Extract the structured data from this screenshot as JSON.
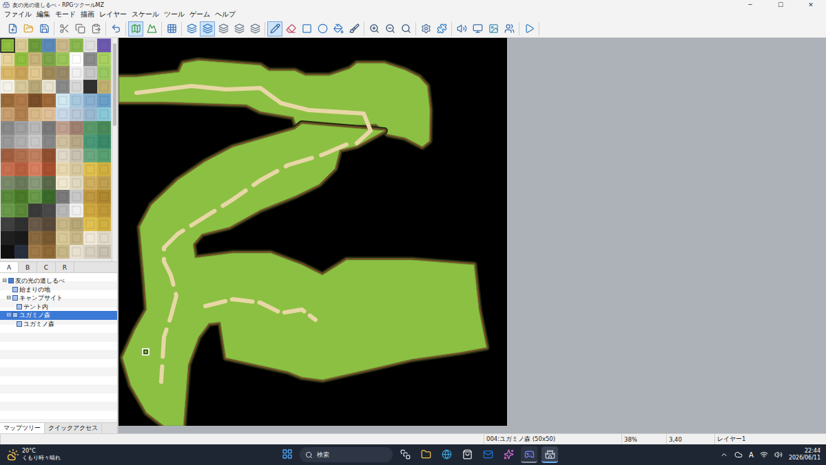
{
  "window": {
    "title": "友の光の道しるべ - RPGツクールMZ",
    "controls": [
      "─",
      "☐",
      "✕"
    ]
  },
  "menu": [
    "ファイル",
    "編集",
    "モード",
    "描画",
    "レイヤー",
    "スケール",
    "ツール",
    "ゲーム",
    "ヘルプ"
  ],
  "toolbar": [
    [
      {
        "selected": false
      },
      {
        "selected": false
      },
      {
        "selected": false
      }
    ],
    [
      {
        "selected": false
      },
      {
        "selected": false
      },
      {
        "selected": false
      }
    ],
    [
      {
        "selected": false
      }
    ],
    [
      {
        "selected": true
      },
      {
        "selected": false
      }
    ],
    [
      {
        "selected": false
      }
    ],
    [
      {
        "selected": false
      },
      {
        "selected": true
      },
      {
        "selected": false
      },
      {
        "selected": false
      },
      {
        "selected": false
      }
    ],
    [
      {
        "selected": true
      },
      {
        "selected": false
      },
      {
        "selected": false
      },
      {
        "selected": false
      },
      {
        "selected": false
      },
      {
        "selected": false
      }
    ],
    [
      {
        "selected": false
      },
      {
        "selected": false
      },
      {
        "selected": false
      }
    ],
    [
      {
        "selected": false
      },
      {
        "selected": false
      }
    ],
    [
      {
        "selected": false
      },
      {
        "selected": false
      },
      {
        "selected": false
      },
      {
        "selected": false
      }
    ],
    [
      {
        "selected": false
      }
    ]
  ],
  "tileset_tabs": [
    {
      "label": "A",
      "selected": true
    },
    {
      "label": "B",
      "selected": false
    },
    {
      "label": "C",
      "selected": false
    },
    {
      "label": "R",
      "selected": false
    }
  ],
  "map_tree": [
    {
      "label": "友の光の道しるべ",
      "depth": 0,
      "toggle": "⊟",
      "kind": "project",
      "selected": false
    },
    {
      "label": "始まりの地",
      "depth": 1,
      "toggle": "",
      "kind": "map",
      "selected": false
    },
    {
      "label": "キャンプサイト",
      "depth": 1,
      "toggle": "⊟",
      "kind": "map",
      "selected": false
    },
    {
      "label": "テント内",
      "depth": 2,
      "toggle": "",
      "kind": "map",
      "selected": false
    },
    {
      "label": "ユガミノ森",
      "depth": 1,
      "toggle": "⊟",
      "kind": "map",
      "selected": true
    },
    {
      "label": "ユガミノ森",
      "depth": 2,
      "toggle": "",
      "kind": "map",
      "selected": false
    }
  ],
  "panel_tabs": [
    {
      "label": "マップツリー",
      "selected": true
    },
    {
      "label": "クイックアクセス",
      "selected": false
    }
  ],
  "status_bar": {
    "map": "004:ユガミノ森 (50x50)",
    "zoom": "38%",
    "coords": "3,40",
    "layer": "レイヤー1"
  },
  "taskbar": {
    "weather": {
      "temp": "20°C",
      "text": "くもり時々晴れ"
    },
    "search": "検索",
    "apps": [
      {
        "running": false,
        "active": false
      },
      {
        "running": false,
        "active": false
      },
      {
        "running": false,
        "active": false
      },
      {
        "running": false,
        "active": false
      },
      {
        "running": false,
        "active": false
      },
      {
        "running": false,
        "active": false
      },
      {
        "running": true,
        "active": false
      },
      {
        "running": true,
        "active": true
      }
    ],
    "ime": "A",
    "time": "22:44",
    "date": "2026/06/11"
  }
}
